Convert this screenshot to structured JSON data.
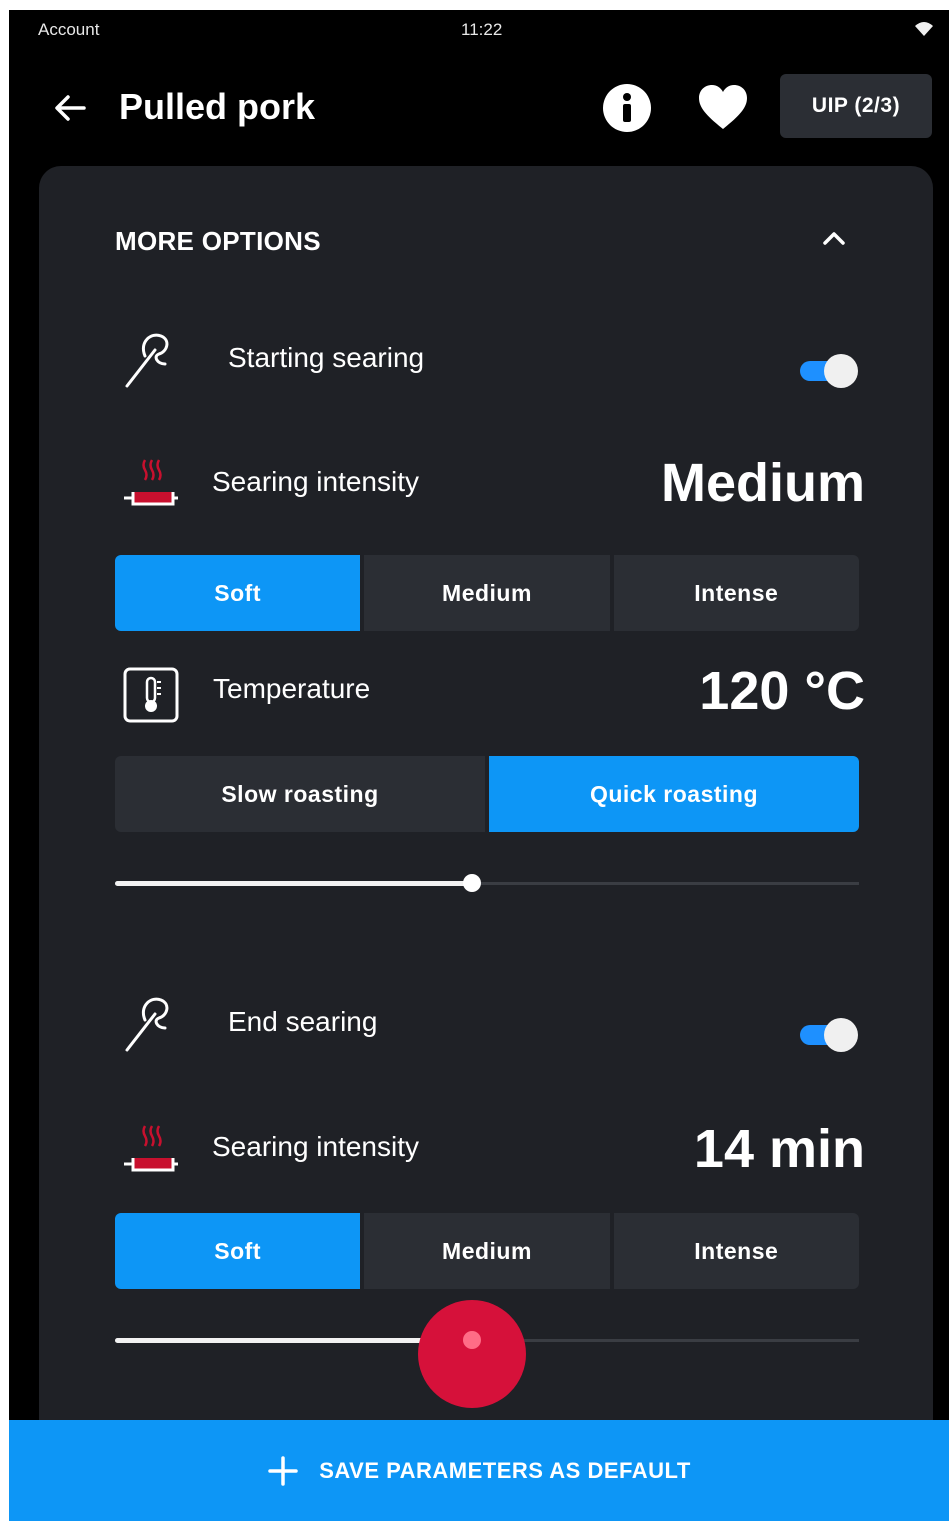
{
  "status_bar": {
    "account": "Account",
    "time": "11:22"
  },
  "header": {
    "title": "Pulled pork",
    "uip_label": "UIP (2/3)"
  },
  "more_options": {
    "title": "MORE OPTIONS",
    "starting_searing": {
      "label": "Starting searing",
      "enabled": true,
      "intensity_label": "Searing intensity",
      "intensity_value": "Medium",
      "intensity_options": [
        "Soft",
        "Medium",
        "Intense"
      ],
      "selected_intensity": "Soft",
      "temperature_label": "Temperature",
      "temperature_value": "120 °C",
      "roasting_options": [
        "Slow roasting",
        "Quick roasting"
      ],
      "selected_roasting": "Quick roasting",
      "slider_level": 0.48
    },
    "end_searing": {
      "label": "End searing",
      "enabled": true,
      "intensity_label": "Searing intensity",
      "intensity_value": "14 min",
      "intensity_options": [
        "Soft",
        "Medium",
        "Intense"
      ],
      "selected_intensity": "Soft",
      "slider_level": 0.48
    }
  },
  "footer": {
    "save_label": "SAVE PARAMETERS AS DEFAULT"
  },
  "colors": {
    "accent": "#0d96f6",
    "touch_indicator": "#d6113a",
    "icon_red": "#c8102e"
  },
  "icons": {
    "back": "arrow-left-icon",
    "info": "info-icon",
    "favorite": "heart-icon",
    "collapse": "chevron-up-icon",
    "searing": "searing-probe-icon",
    "pan": "pan-heat-icon",
    "temperature": "thermometer-icon",
    "add": "plus-icon",
    "wifi": "wifi-icon"
  }
}
